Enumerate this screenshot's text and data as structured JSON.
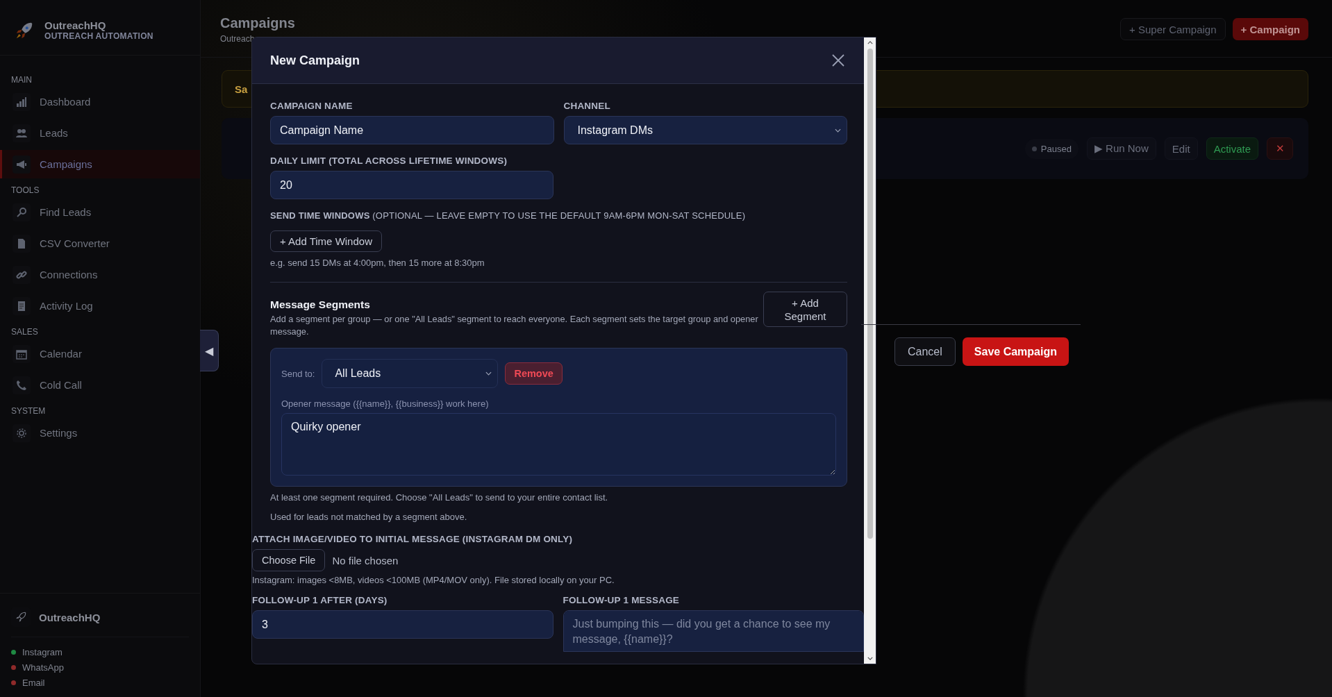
{
  "sidebar": {
    "brand": {
      "name": "OutreachHQ",
      "tagline": "OUTREACH AUTOMATION"
    },
    "sections": [
      {
        "title": "MAIN",
        "items": [
          {
            "label": "Dashboard",
            "selected": false
          },
          {
            "label": "Leads",
            "selected": false
          },
          {
            "label": "Campaigns",
            "selected": true
          }
        ]
      },
      {
        "title": "TOOLS",
        "items": [
          {
            "label": "Find Leads",
            "selected": false
          },
          {
            "label": "CSV Converter",
            "selected": false
          },
          {
            "label": "Connections",
            "selected": false
          },
          {
            "label": "Activity Log",
            "selected": false
          }
        ]
      },
      {
        "title": "SALES",
        "items": [
          {
            "label": "Calendar",
            "selected": false
          },
          {
            "label": "Cold Call",
            "selected": false
          }
        ]
      },
      {
        "title": "SYSTEM",
        "items": [
          {
            "label": "Settings",
            "selected": false
          }
        ]
      }
    ],
    "footer": {
      "name": "OutreachHQ",
      "channels": [
        {
          "label": "Instagram",
          "color": "#1f8a43"
        },
        {
          "label": "WhatsApp",
          "color": "#8f2a2a"
        },
        {
          "label": "Email",
          "color": "#8f2a2a"
        }
      ]
    }
  },
  "collapse_toggle": "◀",
  "page": {
    "title": "Campaigns",
    "subtitle": "Outreach",
    "buttons": [
      {
        "label": "+ Super Campaign",
        "kind": "secondary"
      },
      {
        "label": "+ Campaign",
        "kind": "primary"
      }
    ],
    "banner": "Sa",
    "campaign_card": {
      "status": "Paused",
      "actions": [
        {
          "label": "▶ Run Now",
          "kind": "plain"
        },
        {
          "label": "Edit",
          "kind": "plain"
        },
        {
          "label": "Activate",
          "kind": "success"
        },
        {
          "label": "✕",
          "kind": "danger"
        }
      ]
    }
  },
  "modal": {
    "title": "New Campaign",
    "campaign_name": {
      "label": "CAMPAIGN NAME",
      "value": "Campaign Name"
    },
    "channel": {
      "label": "CHANNEL",
      "value": "Instagram DMs"
    },
    "daily_limit": {
      "label": "DAILY LIMIT (TOTAL ACROSS LIFETIME WINDOWS)",
      "value": "20"
    },
    "send_windows": {
      "label": "**SEND TIME WINDOWS** (OPTIONAL — LEAVE EMPTY TO USE THE DEFAULT 9AM-6PM MON-SAT SCHEDULE)",
      "button": "+ Add Time Window",
      "hint": "e.g. send 15 DMs at 4:00pm, then 15 more at 8:30pm"
    },
    "segments": {
      "title": "Message Segments",
      "description": "Add a segment per group — or one \"All Leads\" segment to reach everyone. Each segment sets the target group and opener message.",
      "add_button": "+ Add Segment",
      "items": [
        {
          "send_to_label": "Send to:",
          "send_to": "All Leads",
          "remove": "Remove",
          "opener_label": "Opener message ({{name}}, {{business}} work here)",
          "opener": "Quirky opener"
        }
      ],
      "hint": "At least one segment required. Choose \"All Leads\" to send to your entire contact list.",
      "fallback_hint": "Used for leads not matched by a segment above."
    },
    "attachment": {
      "label": "ATTACH IMAGE/VIDEO TO INITIAL MESSAGE (INSTAGRAM DM ONLY)",
      "button": "Choose File",
      "status": "No file chosen",
      "hint": "Instagram: images <8MB, videos <100MB (MP4/MOV only). File stored locally on your PC."
    },
    "followup": {
      "days_label": "FOLLOW-UP 1 AFTER (DAYS)",
      "days": "3",
      "message_label": "FOLLOW-UP 1 MESSAGE",
      "message_placeholder": "Just bumping this — did you get a chance to see my message, {{name}}?"
    },
    "footer": {
      "cancel": "Cancel",
      "save": "Save Campaign"
    }
  }
}
